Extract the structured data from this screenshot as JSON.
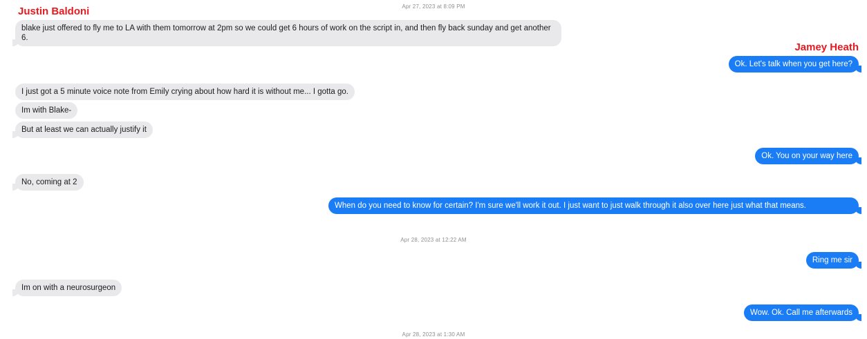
{
  "participants": {
    "left_name": "Justin Baldoni",
    "right_name": "Jamey Heath"
  },
  "timestamps": [
    "Apr 27, 2023 at 8:09 PM",
    "Apr 28, 2023 at 12:22 AM",
    "Apr 28, 2023 at 1:30 AM"
  ],
  "messages": [
    {
      "side": "in",
      "text": "blake just offered to fly me to LA with them tomorrow at 2pm so we could get 6 hours of work on the script in, and then fly back sunday and get another 6."
    },
    {
      "side": "out",
      "text": "Ok.  Let's talk when you get here?"
    },
    {
      "side": "in",
      "text": "I just got a 5 minute voice note from Emily crying about how hard it is without me... I gotta go."
    },
    {
      "side": "in",
      "text": "Im with Blake-"
    },
    {
      "side": "in",
      "text": "But at least we can actually justify it"
    },
    {
      "side": "out",
      "text": "Ok. You on your way here"
    },
    {
      "side": "in",
      "text": "No, coming at 2"
    },
    {
      "side": "out",
      "text": "When do you need to know for certain? I'm sure we'll work it out. I just want to just walk through it also over here just what that means."
    },
    {
      "side": "out",
      "text": "Ring me sir"
    },
    {
      "side": "in",
      "text": "Im on with a neurosurgeon"
    },
    {
      "side": "out",
      "text": "Wow. Ok. Call me afterwards"
    }
  ],
  "colors": {
    "outgoing_bubble": "#1a7df6",
    "incoming_bubble": "#e9e9eb",
    "name_label": "#e8191f"
  }
}
